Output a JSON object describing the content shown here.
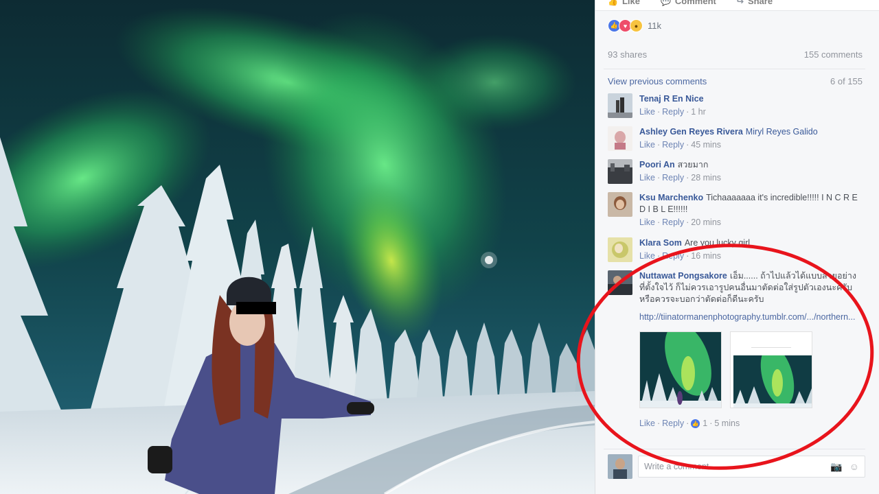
{
  "post_actions": {
    "like_label": "Like",
    "comment_label": "Comment",
    "share_label": "Share"
  },
  "reactions": {
    "icons": [
      "like-icon",
      "love-icon",
      "wow-icon"
    ],
    "count": "11k"
  },
  "stats": {
    "shares": "93 shares",
    "comments": "155 comments"
  },
  "view_previous": {
    "label": "View previous comments",
    "count": "6 of 155"
  },
  "comment_meta": {
    "like": "Like",
    "reply": "Reply",
    "dot": "·"
  },
  "comments": [
    {
      "author": "Tenaj R En Nice",
      "text": "",
      "time": "1 hr"
    },
    {
      "author": "Ashley Gen Reyes Rivera",
      "mention": "Miryl Reyes Galido",
      "time": "45 mins"
    },
    {
      "author": "Poori An",
      "text": "สวยมาก",
      "time": "28 mins"
    },
    {
      "author": "Ksu Marchenko",
      "text": "Tichaaaaaaa it's incredible!!!!! I N C R E D I B L E!!!!!!",
      "time": "20 mins"
    },
    {
      "author": "Klara Som",
      "text": "Are you lucky girl",
      "time": "16 mins"
    },
    {
      "author": "Nuttawat Pongsakore",
      "text": "เอ็ม...... ถ้าไปแล้วได้แบบสวยอย่างที่ตั้งใจไว้ ก็ไม่ควรเอารูปคนอื่นมาตัดต่อใส่รูปตัวเองนะครับ หรือควรจะบอกว่าตัดต่อก็ดีนะครับ",
      "url": "http://tiinatormanenphotography.tumblr.com/.../northern...",
      "like_count": "1",
      "time": "5 mins"
    }
  ],
  "composer": {
    "placeholder": "Write a comment..."
  },
  "colors": {
    "accent_link": "#385898",
    "highlight_ring": "#e8141c",
    "panel_bg": "#f6f7f9"
  }
}
